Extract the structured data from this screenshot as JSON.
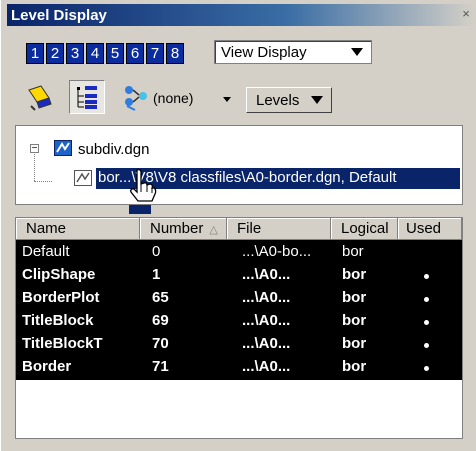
{
  "window": {
    "title": "Level Display",
    "close_glyph": "×"
  },
  "toolbar": {
    "level_buttons": [
      "1",
      "2",
      "3",
      "4",
      "5",
      "6",
      "7",
      "8"
    ],
    "view_select": {
      "value": "View Display"
    },
    "filter": {
      "value": "(none)"
    },
    "levels_button": "Levels"
  },
  "tree": {
    "root": {
      "label": "subdiv.dgn",
      "expander": "−"
    },
    "child": {
      "label": "bor...\\V8\\V8 classfiles\\A0-border.dgn, Default"
    }
  },
  "list": {
    "columns": [
      "Name",
      "Number",
      "File",
      "Logical",
      "Used"
    ],
    "sort_column": "Number",
    "rows": [
      {
        "name": "Default",
        "number": "0",
        "file": "...\\A0-bo...",
        "logical": "bor",
        "used": false
      },
      {
        "name": "ClipShape",
        "number": "1",
        "file": "...\\A0...",
        "logical": "bor",
        "used": true
      },
      {
        "name": "BorderPlot",
        "number": "65",
        "file": "...\\A0...",
        "logical": "bor",
        "used": true
      },
      {
        "name": "TitleBlock",
        "number": "69",
        "file": "...\\A0...",
        "logical": "bor",
        "used": true
      },
      {
        "name": "TitleBlockT",
        "number": "70",
        "file": "...\\A0...",
        "logical": "bor",
        "used": true
      },
      {
        "name": "Border",
        "number": "71",
        "file": "...\\A0...",
        "logical": "bor",
        "used": true
      }
    ]
  },
  "colors": {
    "accent": "#0a246a",
    "level_button": "#0b2c9f",
    "list_bg": "#000000",
    "face": "#d4d0c8"
  },
  "icons": [
    "close-icon",
    "highlighter-icon",
    "hierarchy-list-icon",
    "level-filter-icon",
    "expander-icon",
    "dgn-file-icon",
    "hand-cursor-icon"
  ]
}
